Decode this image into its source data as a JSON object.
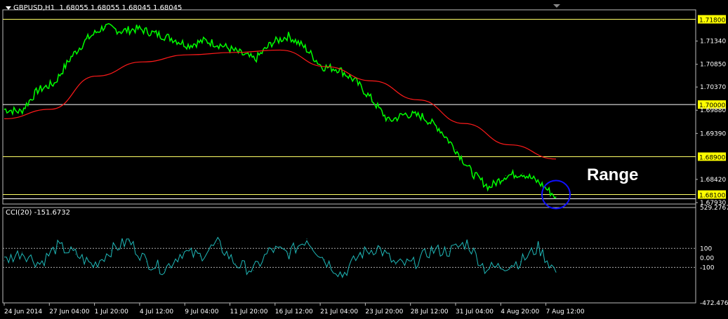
{
  "header": {
    "symbol_tf": "GBPUSD,H1",
    "ohlc": "1.68055 1.68055 1.68045 1.68045"
  },
  "annotation": "Range",
  "colors": {
    "background": "#000000",
    "price": "#00ff00",
    "ma": "#ff1a1a",
    "level_line": "#ffff66",
    "white_line": "#ffffff",
    "cci": "#1fb8b8",
    "circle": "#1010ff",
    "label_bg": "#ffff00"
  },
  "chart_data": [
    {
      "type": "line",
      "title": "GBPUSD,H1",
      "series": [
        {
          "name": "",
          "role": "price",
          "x": [
            "24 Jun 2014",
            "25 Jun",
            "26 Jun",
            "27 Jun",
            "28 Jun",
            "30 Jun",
            "1 Jul",
            "2 Jul",
            "3 Jul",
            "4 Jul",
            "7 Jul",
            "8 Jul",
            "9 Jul",
            "10 Jul",
            "11 Jul",
            "14 Jul",
            "15 Jul",
            "16 Jul",
            "17 Jul",
            "18 Jul",
            "21 Jul",
            "22 Jul",
            "23 Jul",
            "24 Jul",
            "25 Jul",
            "28 Jul",
            "29 Jul",
            "30 Jul",
            "31 Jul",
            "1 Aug",
            "4 Aug",
            "5 Aug",
            "6 Aug",
            "7 Aug"
          ],
          "values": [
            1.699,
            1.6985,
            1.703,
            1.7045,
            1.71,
            1.714,
            1.7165,
            1.7155,
            1.716,
            1.715,
            1.714,
            1.7125,
            1.7135,
            1.7125,
            1.711,
            1.7095,
            1.713,
            1.7145,
            1.712,
            1.708,
            1.7075,
            1.705,
            1.701,
            1.6965,
            1.698,
            1.6975,
            1.695,
            1.6905,
            1.6855,
            1.6825,
            1.685,
            1.6855,
            1.6835,
            1.6805
          ]
        },
        {
          "name": "",
          "role": "moving-average",
          "x": [
            "24 Jun 2014",
            "27 Jun",
            "1 Jul",
            "4 Jul",
            "9 Jul",
            "11 Jul",
            "16 Jul",
            "21 Jul",
            "23 Jul",
            "28 Jul",
            "31 Jul",
            "4 Aug",
            "7 Aug"
          ],
          "values": [
            1.697,
            1.699,
            1.706,
            1.709,
            1.7105,
            1.711,
            1.7115,
            1.708,
            1.705,
            1.701,
            1.696,
            1.6915,
            1.6885
          ]
        }
      ],
      "horizontal_levels": [
        1.718,
        1.7,
        1.689,
        1.681
      ],
      "level_labels": [
        "1.71800",
        "1.70000",
        "1.68900",
        "1.68100"
      ],
      "y_ticks": [
        "1.71340",
        "1.70850",
        "1.70370",
        "1.69880",
        "1.69390",
        "1.68420",
        "1.67930"
      ],
      "ylim": [
        1.679,
        1.72
      ],
      "marked_point": {
        "x": "7 Aug",
        "value": 1.681
      }
    },
    {
      "type": "line",
      "title": "CCI(20) -151.6732",
      "series": [
        {
          "name": "CCI(20)",
          "values": [
            -30,
            60,
            -60,
            120,
            40,
            -80,
            80,
            180,
            -40,
            -120,
            60,
            20,
            150,
            -60,
            -130,
            90,
            50,
            200,
            -20,
            -180,
            40,
            110,
            -70,
            -60,
            80,
            70,
            160,
            -110,
            -90,
            -40,
            110,
            -150
          ]
        }
      ],
      "levels": [
        100,
        0,
        -100
      ],
      "y_ticks": [
        "529.2767",
        "100",
        "0.00",
        "-100",
        "-472.476"
      ],
      "ylim": [
        -472.476,
        529.2767
      ],
      "last_value": -151.6732
    }
  ],
  "x_axis": {
    "labels": [
      "24 Jun 2014",
      "27 Jun 04:00",
      "1 Jul 20:00",
      "4 Jul 12:00",
      "9 Jul 04:00",
      "11 Jul 20:00",
      "16 Jul 12:00",
      "21 Jul 04:00",
      "23 Jul 20:00",
      "28 Jul 12:00",
      "31 Jul 04:00",
      "4 Aug 20:00",
      "7 Aug 12:00"
    ]
  }
}
